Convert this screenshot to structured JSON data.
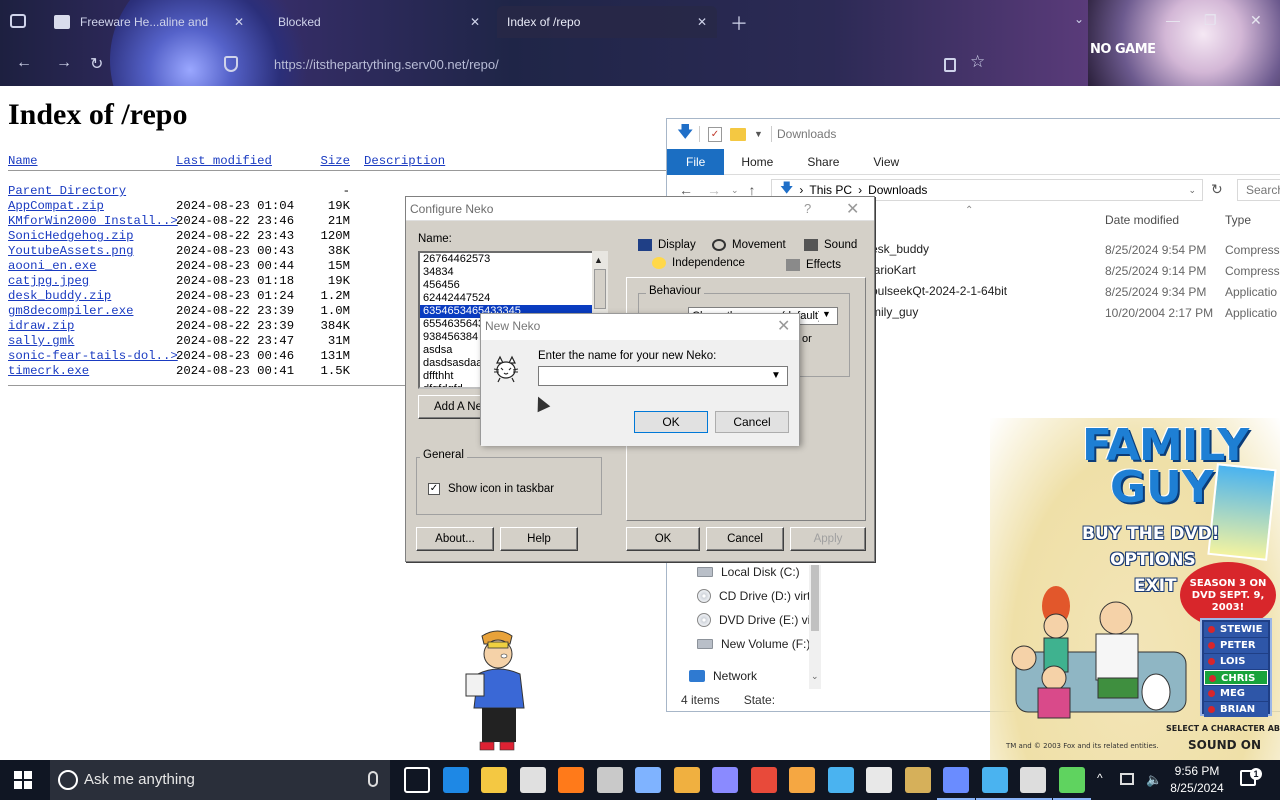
{
  "browser": {
    "tabs": [
      {
        "label": "Freeware He...aline and",
        "active": false
      },
      {
        "label": "Blocked",
        "active": false
      },
      {
        "label": "Index of /repo",
        "active": true
      }
    ],
    "url": "https://itsthepartything.serv00.net/repo/",
    "theme_logo_text": "NO GAME"
  },
  "page": {
    "title": "Index of /repo",
    "columns": {
      "name": "Name",
      "last_modified": "Last modified",
      "size": "Size",
      "description": "Description"
    },
    "parent": {
      "name": "Parent Directory",
      "size": "-"
    },
    "files": [
      {
        "name": "AppCompat.zip",
        "date": "2024-08-23 01:04",
        "size": "19K"
      },
      {
        "name": "KMforWin2000 Install..>",
        "date": "2024-08-22 23:46",
        "size": "21M"
      },
      {
        "name": "SonicHedgehog.zip",
        "date": "2024-08-22 23:43",
        "size": "120M"
      },
      {
        "name": "YoutubeAssets.png",
        "date": "2024-08-23 00:43",
        "size": "38K"
      },
      {
        "name": "aooni_en.exe",
        "date": "2024-08-23 00:44",
        "size": "15M"
      },
      {
        "name": "catjpg.jpeg",
        "date": "2024-08-23 01:18",
        "size": "19K"
      },
      {
        "name": "desk_buddy.zip",
        "date": "2024-08-23 01:24",
        "size": "1.2M"
      },
      {
        "name": "gm8decompiler.exe",
        "date": "2024-08-22 23:39",
        "size": "1.0M"
      },
      {
        "name": "idraw.zip",
        "date": "2024-08-22 23:39",
        "size": "384K"
      },
      {
        "name": "sally.gmk",
        "date": "2024-08-22 23:47",
        "size": "31M"
      },
      {
        "name": "sonic-fear-tails-dol..>",
        "date": "2024-08-23 00:46",
        "size": "131M"
      },
      {
        "name": "timecrk.exe",
        "date": "2024-08-23 00:41",
        "size": "1.5K"
      }
    ]
  },
  "explorer": {
    "title": "Downloads",
    "ribbon": [
      "File",
      "Home",
      "Share",
      "View"
    ],
    "path": [
      "This PC",
      "Downloads"
    ],
    "search_placeholder": "Search",
    "columns": {
      "date": "Date modified",
      "type": "Type"
    },
    "files": [
      {
        "name": "esk_buddy",
        "date": "8/25/2024 9:54 PM",
        "type": "Compresse"
      },
      {
        "name": "larioKart",
        "date": "8/25/2024 9:14 PM",
        "type": "Compresse"
      },
      {
        "name": "oulseekQt-2024-2-1-64bit",
        "date": "8/25/2024 9:34 PM",
        "type": "Applicatio"
      },
      {
        "name": "mily_guy",
        "date": "10/20/2004 2:17 PM",
        "type": "Applicatio"
      }
    ],
    "nav": [
      {
        "label": "Local Disk (C:)",
        "icon": "drive-icon"
      },
      {
        "label": "CD Drive (D:) virt",
        "icon": "cd-icon"
      },
      {
        "label": "DVD Drive (E:) vi",
        "icon": "dvd-icon"
      },
      {
        "label": "New Volume (F:)",
        "icon": "drive-icon"
      },
      {
        "label": "Network",
        "icon": "network-icon"
      }
    ],
    "status_items": "4 items",
    "status_state": "State:"
  },
  "configure_neko": {
    "title": "Configure Neko",
    "help_glyph": "?",
    "name_label": "Name:",
    "names": [
      "26764462573",
      "34834",
      "456456",
      "62442447524",
      "6354653465433345",
      "6554635643",
      "938456384",
      "asdsa",
      "dasdsasdaa",
      "dffthht",
      "dfgfdgfd"
    ],
    "selected_index": 4,
    "add_button": "Add A Ne",
    "tabs_row1": [
      "Display",
      "Movement",
      "Sound"
    ],
    "tabs_row2": [
      "Independence",
      "Effects"
    ],
    "behaviour_label": "Behaviour",
    "behaviour_value": "Chase the mouse (default)",
    "behaviour_fragment": "or",
    "general_label": "General",
    "show_icon_label": "Show icon in taskbar",
    "show_icon_checked": true,
    "buttons": {
      "about": "About...",
      "help": "Help",
      "ok": "OK",
      "cancel": "Cancel",
      "apply": "Apply"
    }
  },
  "new_neko": {
    "title": "New Neko",
    "prompt": "Enter the name for your new Neko:",
    "value": "",
    "ok": "OK",
    "cancel": "Cancel"
  },
  "family_guy_ad": {
    "logo_line1": "FAMILY",
    "logo_line2": "GUY",
    "buy": "BUY THE DVD!",
    "options": "OPTIONS",
    "exit": "EXIT",
    "season": "SEASON 3 ON DVD SEPT. 9, 2003!",
    "characters": [
      "STEWIE",
      "PETER",
      "LOIS",
      "CHRIS",
      "MEG",
      "BRIAN"
    ],
    "selected_character": "CHRIS",
    "select_hint": "SELECT A CHARACTER ABOVE",
    "sound": "SOUND ON",
    "copyright": "TM and © 2003 Fox and its related entities."
  },
  "taskbar": {
    "search_placeholder": "Ask me anything",
    "time": "9:56 PM",
    "date": "8/25/2024",
    "notification_count": "1",
    "apps": [
      {
        "name": "task-view-icon",
        "color": "#ffffff"
      },
      {
        "name": "edge-icon",
        "color": "#1e88e5"
      },
      {
        "name": "file-explorer-icon",
        "color": "#f4c842"
      },
      {
        "name": "store-icon",
        "color": "#e0e0e0"
      },
      {
        "name": "firefox-icon",
        "color": "#ff7a1a"
      },
      {
        "name": "app-grid-icon",
        "color": "#c9c9c9"
      },
      {
        "name": "eyes-icon",
        "color": "#7fb3ff"
      },
      {
        "name": "guitar-icon",
        "color": "#f0b040"
      },
      {
        "name": "upnp-icon",
        "color": "#8a8aff"
      },
      {
        "name": "red-game-icon",
        "color": "#e84a3a"
      },
      {
        "name": "notes-icon",
        "color": "#f5a742"
      },
      {
        "name": "ie-icon",
        "color": "#4ab3f0"
      },
      {
        "name": "mail-icon",
        "color": "#e8e8e8"
      },
      {
        "name": "folder-app-icon",
        "color": "#d6b05a"
      },
      {
        "name": "character-icon",
        "color": "#6a8cff"
      },
      {
        "name": "photos-icon",
        "color": "#4ab3f0"
      },
      {
        "name": "neko-icon",
        "color": "#dddddd"
      },
      {
        "name": "family-guy-icon",
        "color": "#5fd35f"
      }
    ]
  }
}
